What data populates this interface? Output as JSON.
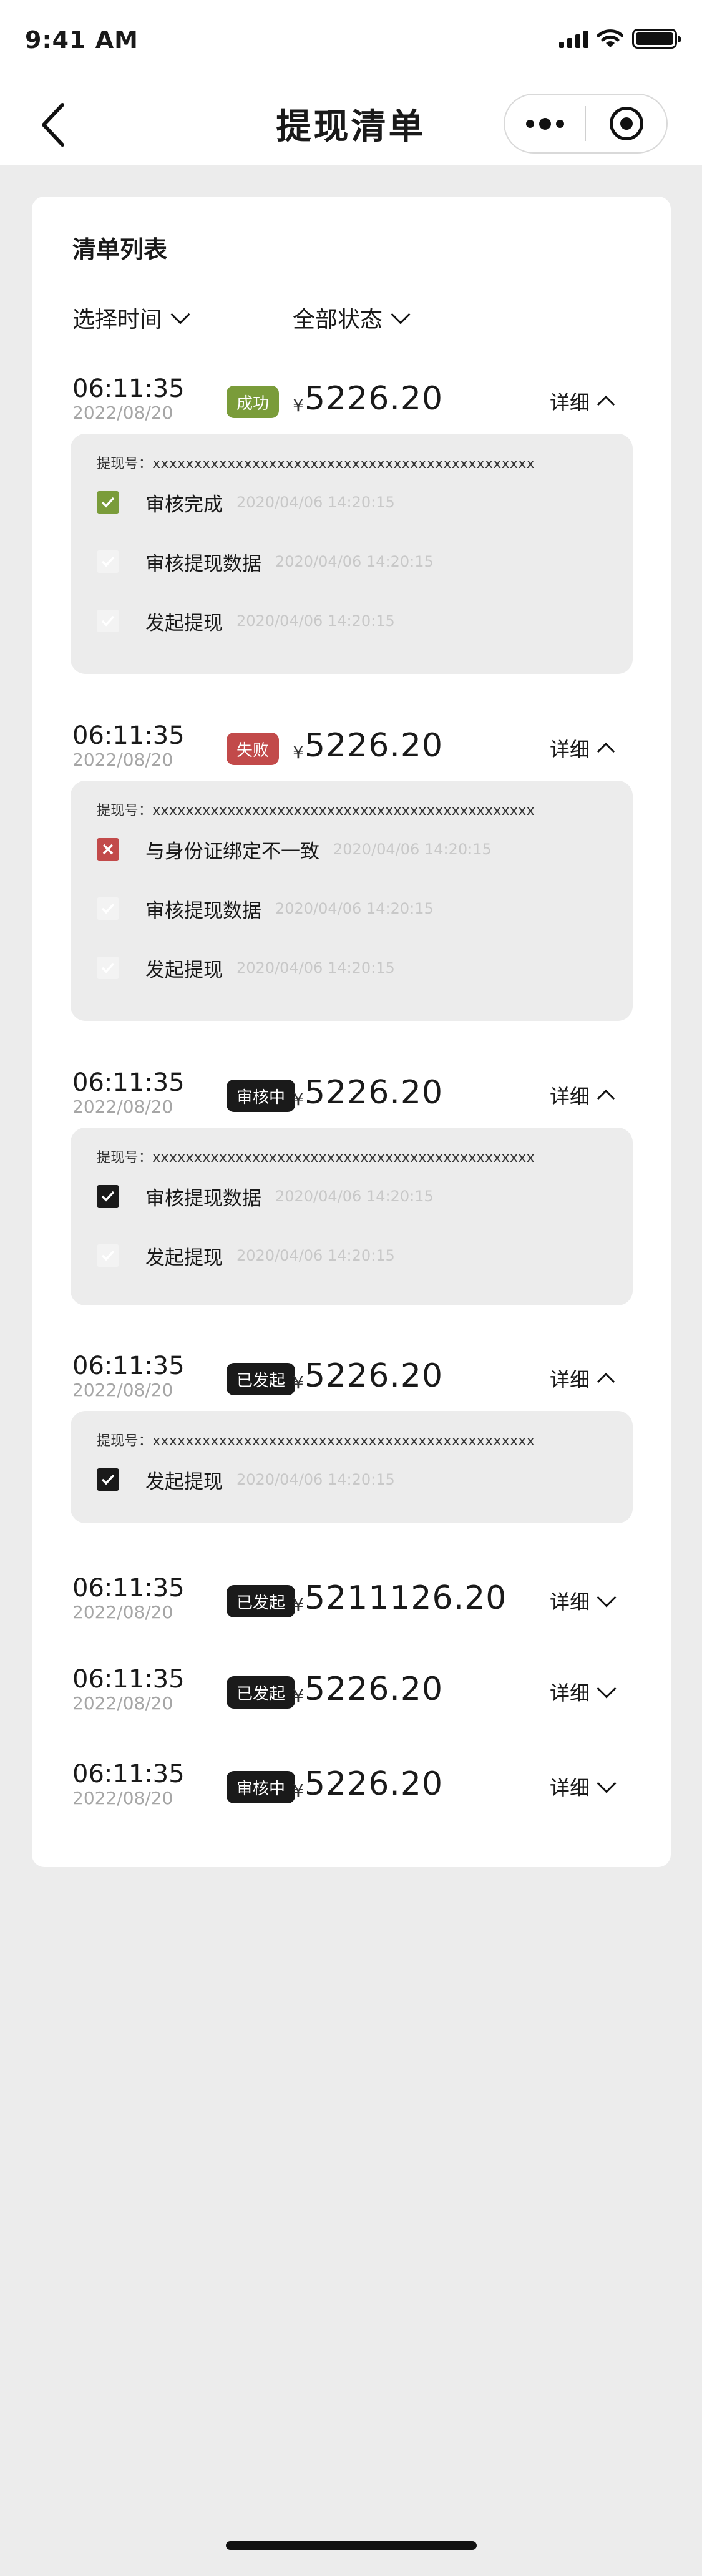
{
  "status_bar": {
    "time": "9:41 AM"
  },
  "nav": {
    "title": "提现清单"
  },
  "list": {
    "title": "清单列表",
    "filter_time": "选择时间",
    "filter_status": "全部状态"
  },
  "colors": {
    "success": "#7a9c3a",
    "fail": "#c24a4a",
    "dark": "#1a1a1a",
    "panel": "#ececec"
  },
  "records": [
    {
      "time": "06:11:35",
      "date": "2022/08/20",
      "status": "成功",
      "currency": "¥",
      "amount": "5226.20",
      "detail": "详细",
      "withdraw_no_label": "提现号：xxxxxxxxxxxxxxxxxxxxxxxxxxxxxxxxxxxxxxxxxxxxxx",
      "steps": [
        {
          "label": "审核完成",
          "time": "2020/04/06 14:20:15"
        },
        {
          "label": "审核提现数据",
          "time": "2020/04/06 14:20:15"
        },
        {
          "label": "发起提现",
          "time": "2020/04/06 14:20:15"
        }
      ]
    },
    {
      "time": "06:11:35",
      "date": "2022/08/20",
      "status": "失败",
      "currency": "¥",
      "amount": "5226.20",
      "detail": "详细",
      "withdraw_no_label": "提现号：xxxxxxxxxxxxxxxxxxxxxxxxxxxxxxxxxxxxxxxxxxxxxx",
      "steps": [
        {
          "label": "与身份证绑定不一致",
          "time": "2020/04/06 14:20:15"
        },
        {
          "label": "审核提现数据",
          "time": "2020/04/06 14:20:15"
        },
        {
          "label": "发起提现",
          "time": "2020/04/06 14:20:15"
        }
      ]
    },
    {
      "time": "06:11:35",
      "date": "2022/08/20",
      "status": "审核中",
      "currency": "¥",
      "amount": "5226.20",
      "detail": "详细",
      "withdraw_no_label": "提现号：xxxxxxxxxxxxxxxxxxxxxxxxxxxxxxxxxxxxxxxxxxxxxx",
      "steps": [
        {
          "label": "审核提现数据",
          "time": "2020/04/06 14:20:15"
        },
        {
          "label": "发起提现",
          "time": "2020/04/06 14:20:15"
        }
      ]
    },
    {
      "time": "06:11:35",
      "date": "2022/08/20",
      "status": "已发起",
      "currency": "¥",
      "amount": "5226.20",
      "detail": "详细",
      "withdraw_no_label": "提现号：xxxxxxxxxxxxxxxxxxxxxxxxxxxxxxxxxxxxxxxxxxxxxx",
      "steps": [
        {
          "label": "发起提现",
          "time": "2020/04/06 14:20:15"
        }
      ]
    },
    {
      "time": "06:11:35",
      "date": "2022/08/20",
      "status": "已发起",
      "currency": "¥",
      "amount": "5211126.20",
      "detail": "详细"
    },
    {
      "time": "06:11:35",
      "date": "2022/08/20",
      "status": "已发起",
      "currency": "¥",
      "amount": "5226.20",
      "detail": "详细"
    },
    {
      "time": "06:11:35",
      "date": "2022/08/20",
      "status": "审核中",
      "currency": "¥",
      "amount": "5226.20",
      "detail": "详细"
    }
  ]
}
